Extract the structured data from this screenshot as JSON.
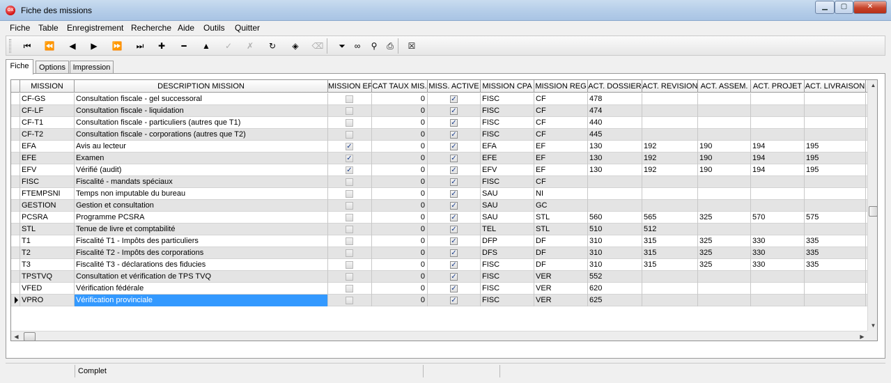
{
  "window": {
    "title": "Fiche des missions",
    "app_icon_text": "OX"
  },
  "menu": [
    "Fiche",
    "Table",
    "Enregistrement",
    "Recherche",
    "Aide",
    "Outils",
    "Quitter"
  ],
  "toolbar": {
    "items": [
      {
        "name": "first-record-icon",
        "glyph": "⏮",
        "disabled": false
      },
      {
        "name": "prev-page-icon",
        "glyph": "⏪",
        "disabled": false
      },
      {
        "name": "prev-record-icon",
        "glyph": "◀",
        "disabled": false
      },
      {
        "name": "next-record-icon",
        "glyph": "▶",
        "disabled": false
      },
      {
        "name": "next-page-icon",
        "glyph": "⏩",
        "disabled": false
      },
      {
        "name": "last-record-icon",
        "glyph": "⏭",
        "disabled": false
      },
      {
        "name": "add-record-icon",
        "glyph": "✚",
        "disabled": false
      },
      {
        "name": "delete-record-icon",
        "glyph": "━",
        "disabled": false
      },
      {
        "name": "edit-record-icon",
        "glyph": "▲",
        "disabled": false
      },
      {
        "name": "confirm-icon",
        "glyph": "✓",
        "disabled": true
      },
      {
        "name": "cancel-edit-icon",
        "glyph": "✗",
        "disabled": true
      },
      {
        "name": "refresh-icon",
        "glyph": "↻",
        "disabled": false
      },
      {
        "name": "bookmark-icon",
        "glyph": "◈",
        "disabled": false
      },
      {
        "name": "clear-bookmark-icon",
        "glyph": "⌫",
        "disabled": true
      },
      {
        "name": "filter-icon",
        "glyph": "⏷",
        "disabled": false
      },
      {
        "name": "find-binoculars-icon",
        "glyph": "∞",
        "disabled": false
      },
      {
        "name": "search-icon",
        "glyph": "⚲",
        "disabled": false
      },
      {
        "name": "print-icon",
        "glyph": "⎙",
        "disabled": false
      },
      {
        "name": "close-form-icon",
        "glyph": "☒",
        "disabled": false
      }
    ]
  },
  "tabs": [
    "Fiche",
    "Options",
    "Impression"
  ],
  "grid": {
    "columns": [
      "MISSION",
      "DESCRIPTION MISSION",
      "MISSION EF",
      "CAT TAUX MIS.",
      "MISS. ACTIVE",
      "MISSION CPA",
      "MISSION REG",
      "ACT. DOSSIER",
      "ACT. REVISION",
      "ACT. ASSEM.",
      "ACT. PROJET",
      "ACT. LIVRAISON"
    ],
    "rows": [
      {
        "mission": "CF-GS",
        "desc": "Consultation fiscale - gel successoral",
        "ef": false,
        "cat": "0",
        "active": true,
        "cpa": "FISC",
        "reg": "CF",
        "dossier": "478",
        "revision": "",
        "assem": "",
        "projet": "",
        "livraison": ""
      },
      {
        "mission": "CF-LF",
        "desc": "Consultation fiscale - liquidation",
        "ef": false,
        "cat": "0",
        "active": true,
        "cpa": "FISC",
        "reg": "CF",
        "dossier": "474",
        "revision": "",
        "assem": "",
        "projet": "",
        "livraison": ""
      },
      {
        "mission": "CF-T1",
        "desc": "Consultation fiscale - particuliers (autres que T1)",
        "ef": false,
        "cat": "0",
        "active": true,
        "cpa": "FISC",
        "reg": "CF",
        "dossier": "440",
        "revision": "",
        "assem": "",
        "projet": "",
        "livraison": ""
      },
      {
        "mission": "CF-T2",
        "desc": "Consultation fiscale - corporations (autres que T2)",
        "ef": false,
        "cat": "0",
        "active": true,
        "cpa": "FISC",
        "reg": "CF",
        "dossier": "445",
        "revision": "",
        "assem": "",
        "projet": "",
        "livraison": ""
      },
      {
        "mission": "EFA",
        "desc": "Avis au lecteur",
        "ef": true,
        "cat": "0",
        "active": true,
        "cpa": "EFA",
        "reg": "EF",
        "dossier": "130",
        "revision": "192",
        "assem": "190",
        "projet": "194",
        "livraison": "195"
      },
      {
        "mission": "EFE",
        "desc": "Examen",
        "ef": true,
        "cat": "0",
        "active": true,
        "cpa": "EFE",
        "reg": "EF",
        "dossier": "130",
        "revision": "192",
        "assem": "190",
        "projet": "194",
        "livraison": "195"
      },
      {
        "mission": "EFV",
        "desc": "Vérifié (audit)",
        "ef": true,
        "cat": "0",
        "active": true,
        "cpa": "EFV",
        "reg": "EF",
        "dossier": "130",
        "revision": "192",
        "assem": "190",
        "projet": "194",
        "livraison": "195"
      },
      {
        "mission": "FISC",
        "desc": "Fiscalité - mandats spéciaux",
        "ef": false,
        "cat": "0",
        "active": true,
        "cpa": "FISC",
        "reg": "CF",
        "dossier": "",
        "revision": "",
        "assem": "",
        "projet": "",
        "livraison": ""
      },
      {
        "mission": "FTEMPSNI",
        "desc": "Temps non imputable du bureau",
        "ef": false,
        "cat": "0",
        "active": true,
        "cpa": "SAU",
        "reg": "NI",
        "dossier": "",
        "revision": "",
        "assem": "",
        "projet": "",
        "livraison": ""
      },
      {
        "mission": "GESTION",
        "desc": "Gestion et consultation",
        "ef": false,
        "cat": "0",
        "active": true,
        "cpa": "SAU",
        "reg": "GC",
        "dossier": "",
        "revision": "",
        "assem": "",
        "projet": "",
        "livraison": ""
      },
      {
        "mission": "PCSRA",
        "desc": "Programme PCSRA",
        "ef": false,
        "cat": "0",
        "active": true,
        "cpa": "SAU",
        "reg": "STL",
        "dossier": "560",
        "revision": "565",
        "assem": "325",
        "projet": "570",
        "livraison": "575"
      },
      {
        "mission": "STL",
        "desc": "Tenue de livre et comptabilité",
        "ef": false,
        "cat": "0",
        "active": true,
        "cpa": "TEL",
        "reg": "STL",
        "dossier": "510",
        "revision": "512",
        "assem": "",
        "projet": "",
        "livraison": ""
      },
      {
        "mission": "T1",
        "desc": "Fiscalité T1 - Impôts des particuliers",
        "ef": false,
        "cat": "0",
        "active": true,
        "cpa": "DFP",
        "reg": "DF",
        "dossier": "310",
        "revision": "315",
        "assem": "325",
        "projet": "330",
        "livraison": "335"
      },
      {
        "mission": "T2",
        "desc": "Fiscalité T2 - Impôts des corporations",
        "ef": false,
        "cat": "0",
        "active": true,
        "cpa": "DFS",
        "reg": "DF",
        "dossier": "310",
        "revision": "315",
        "assem": "325",
        "projet": "330",
        "livraison": "335"
      },
      {
        "mission": "T3",
        "desc": "Fiscalité T3 - déclarations des fiducies",
        "ef": false,
        "cat": "0",
        "active": true,
        "cpa": "FISC",
        "reg": "DF",
        "dossier": "310",
        "revision": "315",
        "assem": "325",
        "projet": "330",
        "livraison": "335"
      },
      {
        "mission": "TPSTVQ",
        "desc": "Consultation et vérification de TPS TVQ",
        "ef": false,
        "cat": "0",
        "active": true,
        "cpa": "FISC",
        "reg": "VER",
        "dossier": "552",
        "revision": "",
        "assem": "",
        "projet": "",
        "livraison": ""
      },
      {
        "mission": "VFED",
        "desc": "Vérification fédérale",
        "ef": false,
        "cat": "0",
        "active": true,
        "cpa": "FISC",
        "reg": "VER",
        "dossier": "620",
        "revision": "",
        "assem": "",
        "projet": "",
        "livraison": ""
      },
      {
        "mission": "VPRO",
        "desc": "Vérification provinciale",
        "ef": false,
        "cat": "0",
        "active": true,
        "cpa": "FISC",
        "reg": "VER",
        "dossier": "625",
        "revision": "",
        "assem": "",
        "projet": "",
        "livraison": ""
      }
    ],
    "current_row": 17
  },
  "status": {
    "panel2": "Complet"
  },
  "colors": {
    "selection": "#3399ff",
    "alt_row": "#e4e4e4",
    "checkmark": "#1a3d8a"
  }
}
